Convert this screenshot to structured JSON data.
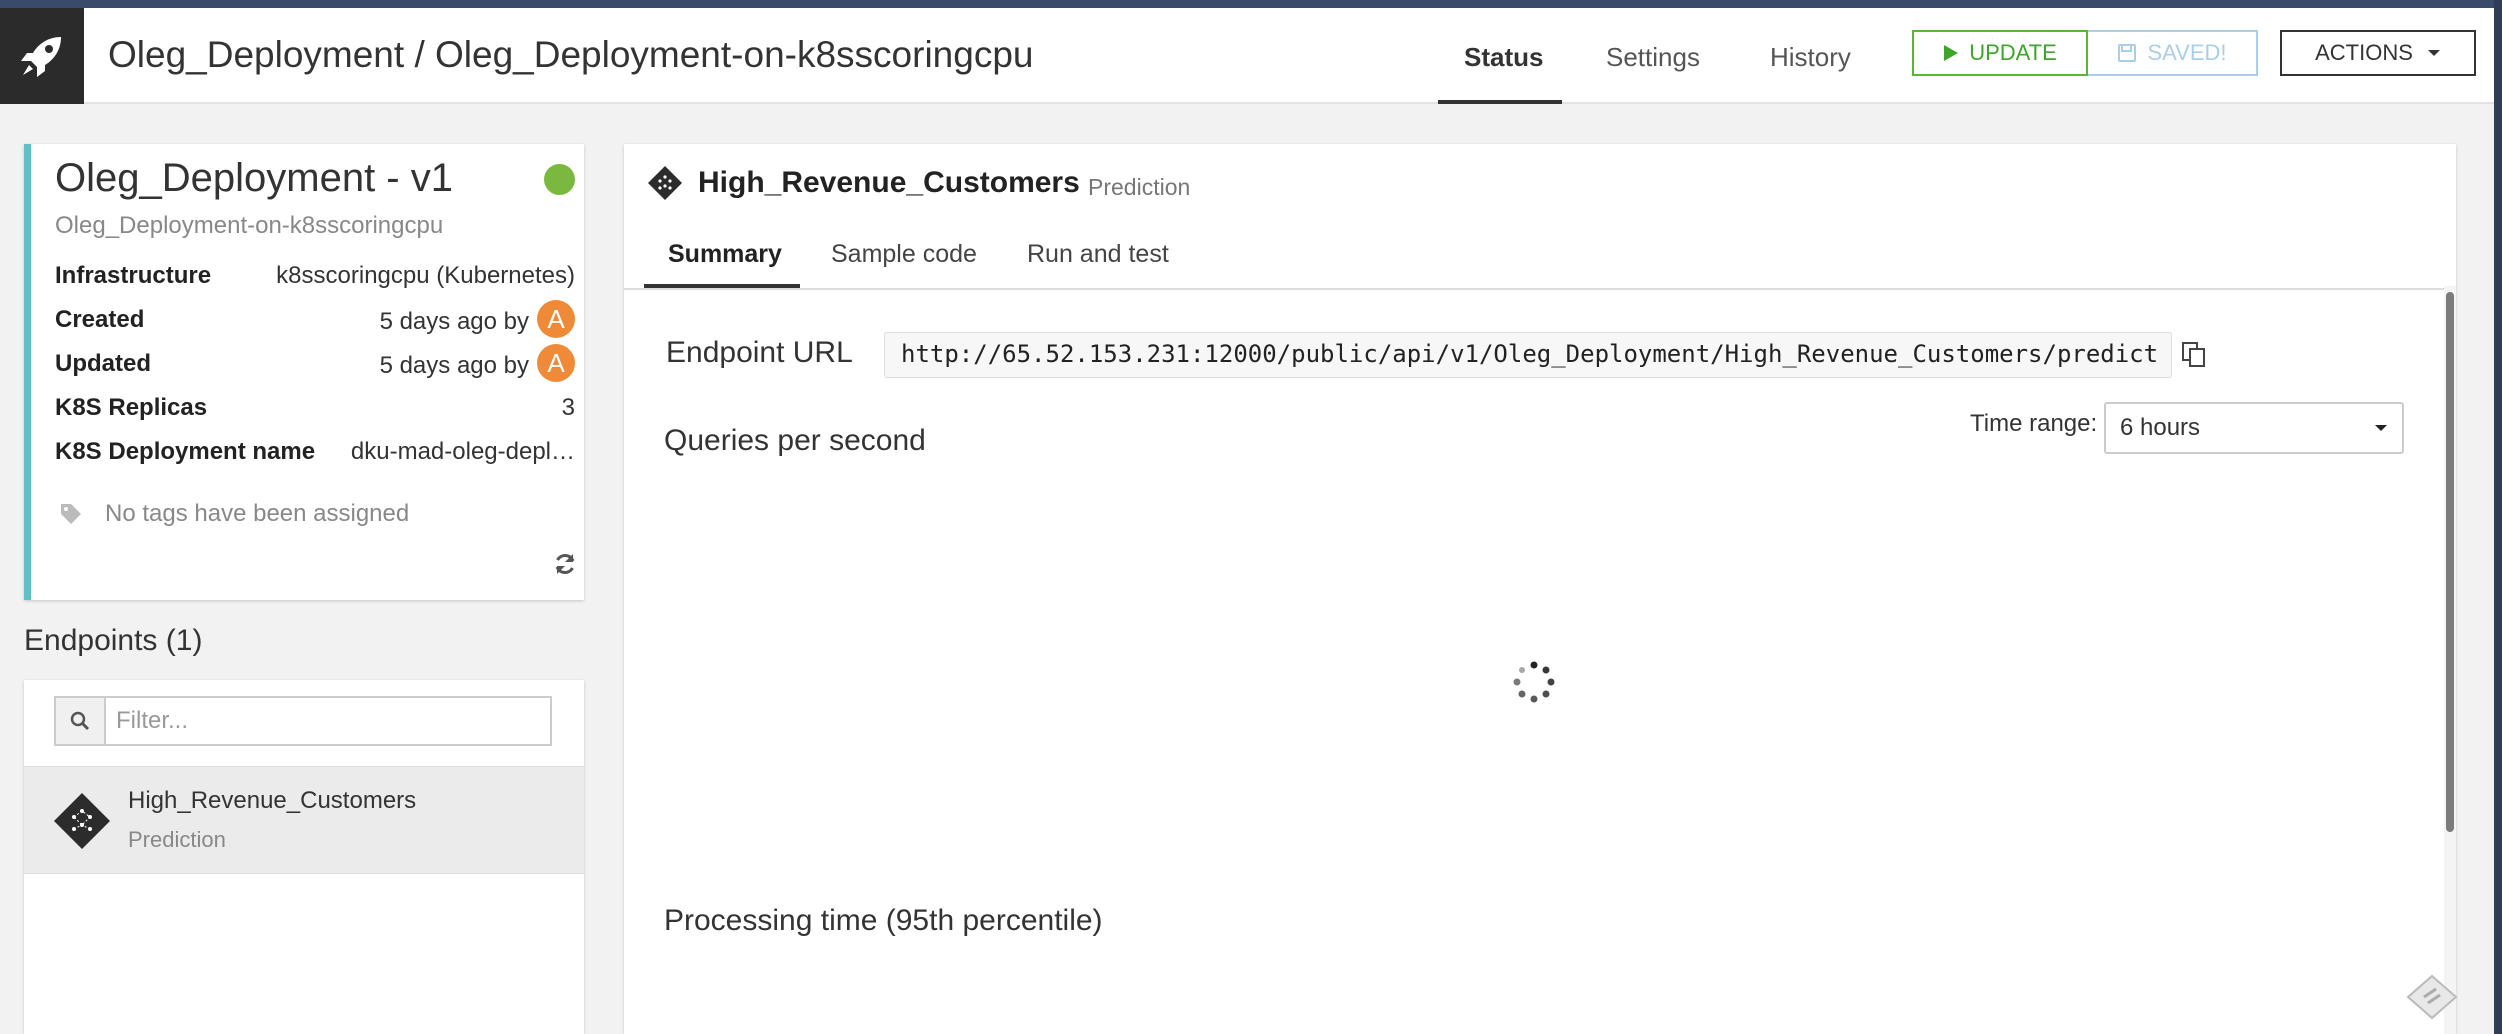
{
  "header": {
    "breadcrumb": "Oleg_Deployment / Oleg_Deployment-on-k8sscoringcpu",
    "tabs": [
      {
        "label": "Status",
        "active": true
      },
      {
        "label": "Settings",
        "active": false
      },
      {
        "label": "History",
        "active": false
      }
    ],
    "update_label": "UPDATE",
    "saved_label": "SAVED!",
    "actions_label": "ACTIONS"
  },
  "deployment": {
    "title": "Oleg_Deployment - v1",
    "subtitle": "Oleg_Deployment-on-k8sscoringcpu",
    "status_color": "#7ab83f",
    "properties": [
      {
        "label": "Infrastructure",
        "value": "k8sscoringcpu (Kubernetes)"
      },
      {
        "label": "Created",
        "value": "5 days ago by",
        "avatar": "A"
      },
      {
        "label": "Updated",
        "value": "5 days ago by",
        "avatar": "A"
      },
      {
        "label": "K8S Replicas",
        "value": "3"
      },
      {
        "label": "K8S Deployment name",
        "value": "dku-mad-oleg-depl…"
      }
    ],
    "tags_text": "No tags have been assigned"
  },
  "endpoints": {
    "title": "Endpoints (1)",
    "filter_placeholder": "Filter...",
    "items": [
      {
        "name": "High_Revenue_Customers",
        "type": "Prediction"
      }
    ]
  },
  "main": {
    "title": "High_Revenue_Customers",
    "type": "Prediction",
    "tabs": [
      {
        "label": "Summary",
        "active": true
      },
      {
        "label": "Sample code",
        "active": false
      },
      {
        "label": "Run and test",
        "active": false
      }
    ],
    "endpoint_url_label": "Endpoint URL",
    "endpoint_url": "http://65.52.153.231:12000/public/api/v1/Oleg_Deployment/High_Revenue_Customers/predict",
    "qps_title": "Queries per second",
    "time_range_label": "Time range:",
    "time_range_value": "6 hours",
    "processing_title": "Processing time (95th percentile)"
  },
  "colors": {
    "accent_teal": "#5fc1c4",
    "update_green": "#3ea52a",
    "saved_blue": "#a9cfe8",
    "avatar_orange": "#ee8a38"
  }
}
